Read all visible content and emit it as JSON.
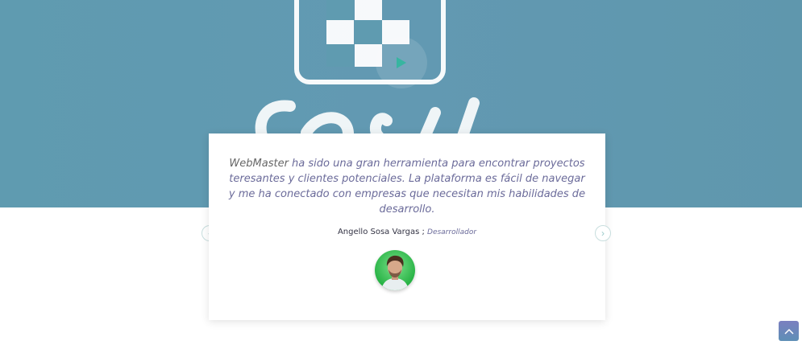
{
  "hero": {
    "play_icon": "play-icon",
    "play_color": "#37b5a0",
    "background_color": "#6299b2"
  },
  "testimonial": {
    "brand": "WebMaster",
    "text": " ha sido una gran herramienta para encontrar proyectos teresantes y clientes potenciales. La plataforma es fácil de navegar y me ha conectado con empresas que necesitan mis habilidades de desarrollo.",
    "author": "Angello Sosa Vargas",
    "separator": " ; ",
    "role": "Desarrollador"
  },
  "slider": {
    "prev_icon": "chevron-left-icon",
    "next_icon": "chevron-right-icon"
  },
  "scroll_top": {
    "icon": "chevron-up-icon"
  }
}
